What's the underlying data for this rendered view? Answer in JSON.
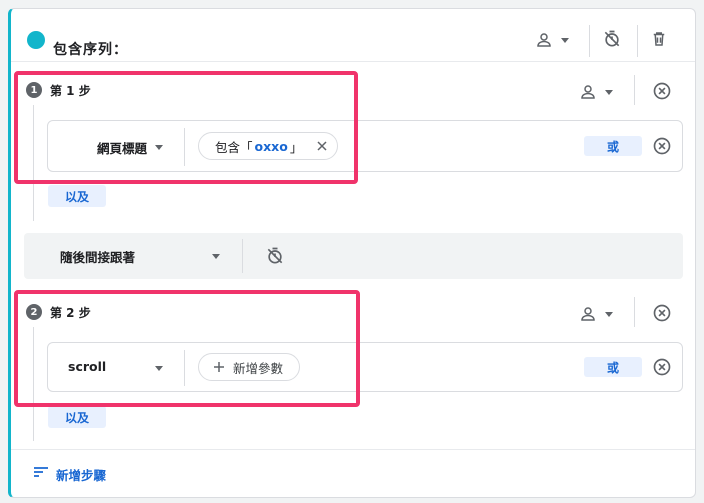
{
  "header": {
    "title": "包含序列："
  },
  "steps": [
    {
      "number": "1",
      "label": "第 1 步",
      "dimension": "網頁標題",
      "chip": {
        "prefix": "包含「",
        "value": "oxxo",
        "suffix": "」"
      },
      "or_label": "或",
      "and_label": "以及"
    },
    {
      "number": "2",
      "label": "第 2 步",
      "dimension": "scroll",
      "add_param_label": "新增參數",
      "or_label": "或",
      "and_label": "以及"
    }
  ],
  "follow": {
    "label": "隨後間接跟著"
  },
  "footer": {
    "add_step_label": "新增步驟"
  },
  "colors": {
    "accent": "#12b5cb",
    "highlight": "#f0336b",
    "link": "#1967d2"
  }
}
